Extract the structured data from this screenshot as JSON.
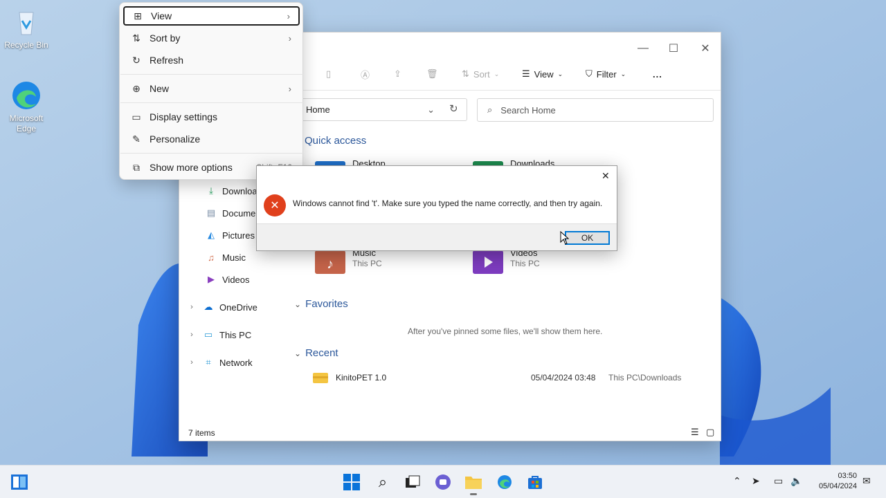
{
  "desktop": {
    "icons": [
      {
        "label": "Recycle Bin",
        "icon": "recycle-bin-icon"
      },
      {
        "label": "Microsoft Edge",
        "icon": "edge-icon"
      }
    ]
  },
  "context_menu": {
    "items": [
      {
        "label": "View",
        "icon": "grid-icon",
        "submenu": true
      },
      {
        "label": "Sort by",
        "icon": "sort-icon",
        "submenu": true
      },
      {
        "label": "Refresh",
        "icon": "refresh-icon"
      },
      {
        "label": "New",
        "icon": "plus-circle-icon",
        "submenu": true
      },
      {
        "label": "Display settings",
        "icon": "display-icon"
      },
      {
        "label": "Personalize",
        "icon": "brush-icon"
      },
      {
        "label": "Show more options",
        "icon": "more-options-icon",
        "shortcut": "Shift+F10"
      }
    ]
  },
  "explorer": {
    "toolbar": {
      "sort": "Sort",
      "view": "View",
      "filter": "Filter",
      "more": "..."
    },
    "address": "Home",
    "search_placeholder": "Search Home",
    "nav": [
      {
        "label": "Downloads",
        "icon": "download-icon"
      },
      {
        "label": "Documents",
        "icon": "document-icon"
      },
      {
        "label": "Pictures",
        "icon": "pictures-icon"
      },
      {
        "label": "Music",
        "icon": "music-icon"
      },
      {
        "label": "Videos",
        "icon": "videos-icon"
      },
      {
        "label": "OneDrive",
        "icon": "cloud-icon"
      },
      {
        "label": "This PC",
        "icon": "pc-icon"
      },
      {
        "label": "Network",
        "icon": "network-icon"
      }
    ],
    "quick_access_title": "Quick access",
    "quick_access": [
      {
        "name": "Desktop",
        "location": "",
        "icon": "folder-desktop-icon"
      },
      {
        "name": "Downloads",
        "location": "",
        "icon": "folder-downloads-icon"
      },
      {
        "name": "Music",
        "location": "This PC",
        "icon": "folder-music-icon"
      },
      {
        "name": "Videos",
        "location": "This PC",
        "icon": "folder-videos-icon"
      }
    ],
    "favorites_title": "Favorites",
    "favorites_empty": "After you've pinned some files, we'll show them here.",
    "recent_title": "Recent",
    "recent": [
      {
        "name": "KinitoPET 1.0",
        "date": "05/04/2024 03:48",
        "location": "This PC\\Downloads"
      }
    ],
    "status": "7 items"
  },
  "dialog": {
    "message": "Windows cannot find 't'. Make sure you typed the name correctly, and then try again.",
    "ok_label": "OK",
    "close_glyph": "✕"
  },
  "taskbar": {
    "time": "03:50",
    "date": "05/04/2024"
  },
  "colors": {
    "accent": "#0078d4",
    "error": "#e0401c",
    "section_heading": "#2b579a"
  }
}
